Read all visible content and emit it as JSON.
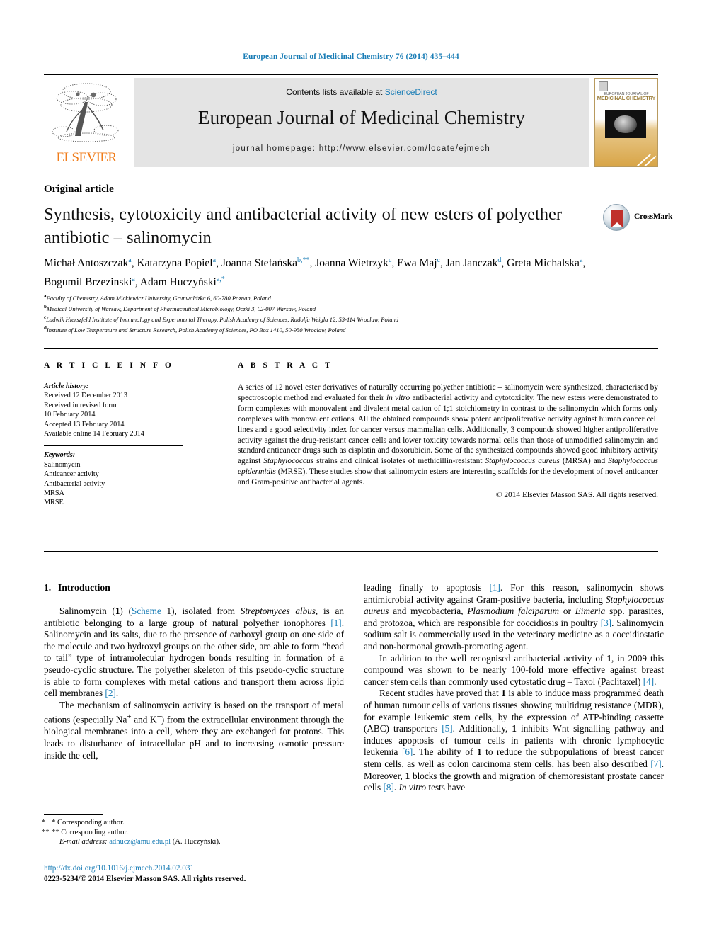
{
  "running_head": "European Journal of Medicinal Chemistry 76 (2014) 435–444",
  "masthead": {
    "contents_prefix": "Contents lists available at ",
    "sciencedirect": "ScienceDirect",
    "journal_title": "European Journal of Medicinal Chemistry",
    "homepage": "journal homepage: http://www.elsevier.com/locate/ejmech",
    "publisher_word": "ELSEVIER",
    "cover_title_small": "EUROPEAN JOURNAL OF",
    "cover_title_main": "MEDICINAL CHEMISTRY"
  },
  "article": {
    "kind": "Original article",
    "title": "Synthesis, cytotoxicity and antibacterial activity of new esters of polyether antibiotic – salinomycin",
    "crossmark_label": "CrossMark",
    "authors": [
      {
        "name": "Michał Antoszczak",
        "sup": "a",
        "sep": ", "
      },
      {
        "name": "Katarzyna Popiel",
        "sup": "a",
        "sep": ", "
      },
      {
        "name": "Joanna Stefańska",
        "sup": "b,**",
        "sep": ", "
      },
      {
        "name": "Joanna Wietrzyk",
        "sup": "c",
        "sep": ", "
      },
      {
        "name": "Ewa Maj",
        "sup": "c",
        "sep": ", "
      },
      {
        "name": "Jan Janczak",
        "sup": "d",
        "sep": ", "
      },
      {
        "name": "Greta Michalska",
        "sup": "a",
        "sep": ", "
      },
      {
        "name": "Bogumil Brzezinski",
        "sup": "a",
        "sep": ", "
      },
      {
        "name": "Adam Huczyński",
        "sup": "a,*",
        "sep": ""
      }
    ],
    "affiliations": [
      {
        "mark": "a",
        "text": "Faculty of Chemistry, Adam Mickiewicz University, Grunwaldzka 6, 60-780 Poznan, Poland"
      },
      {
        "mark": "b",
        "text": "Medical University of Warsaw, Department of Pharmaceutical Microbiology, Oczki 3, 02-007 Warsaw, Poland"
      },
      {
        "mark": "c",
        "text": "Ludwik Hierszfeld Institute of Immunology and Experimental Therapy, Polish Academy of Sciences, Rudolfa Weigla 12, 53-114 Wroclaw, Poland"
      },
      {
        "mark": "d",
        "text": "Institute of Low Temperature and Structure Research, Polish Academy of Sciences, PO Box 1410, 50-950 Wroclaw, Poland"
      }
    ]
  },
  "article_info": {
    "heading": "A R T I C L E   I N F O",
    "history_label": "Article history:",
    "history": [
      "Received 12 December 2013",
      "Received in revised form",
      "10 February 2014",
      "Accepted 13 February 2014",
      "Available online 14 February 2014"
    ],
    "keywords_label": "Keywords:",
    "keywords": [
      "Salinomycin",
      "Anticancer activity",
      "Antibacterial activity",
      "MRSA",
      "MRSE"
    ]
  },
  "abstract": {
    "heading": "A B S T R A C T",
    "copyright": "© 2014 Elsevier Masson SAS. All rights reserved."
  },
  "introduction": {
    "heading_number": "1.",
    "heading_text": "Introduction"
  },
  "footnotes": {
    "star": "* Corresponding author.",
    "doublestar": "** Corresponding author.",
    "email_label": "E-mail address:",
    "email": "adhucz@amu.edu.pl",
    "email_owner": "(A. Huczyński)."
  },
  "footer": {
    "doi": "http://dx.doi.org/10.1016/j.ejmech.2014.02.031",
    "issn_line": "0223-5234/© 2014 Elsevier Masson SAS. All rights reserved."
  },
  "colors": {
    "link": "#1a7db6",
    "elsevier_orange": "#f07c1a",
    "band_gray": "#e4e4e4",
    "crossmark_red": "#c0302b"
  }
}
